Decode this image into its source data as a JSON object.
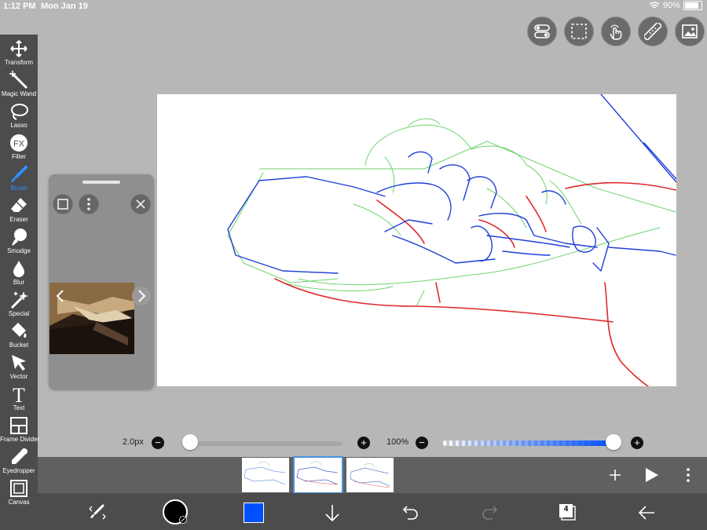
{
  "status": {
    "time": "1:12 PM",
    "date": "Mon Jan 19",
    "battery": "90%"
  },
  "tools": [
    {
      "label": "Transform",
      "icon": "move-icon"
    },
    {
      "label": "Magic Wand",
      "icon": "magic-wand-icon"
    },
    {
      "label": "Lasso",
      "icon": "lasso-icon"
    },
    {
      "label": "Filter",
      "icon": "fx-icon"
    },
    {
      "label": "Brush",
      "icon": "brush-icon",
      "active": true
    },
    {
      "label": "Eraser",
      "icon": "eraser-icon"
    },
    {
      "label": "Smudge",
      "icon": "smudge-icon"
    },
    {
      "label": "Blur",
      "icon": "blur-drop-icon"
    },
    {
      "label": "Special",
      "icon": "sparkle-icon"
    },
    {
      "label": "Bucket",
      "icon": "bucket-icon"
    },
    {
      "label": "Vector",
      "icon": "cursor-icon"
    },
    {
      "label": "Text",
      "icon": "text-icon"
    },
    {
      "label": "Frame Divider",
      "icon": "frame-divider-icon"
    },
    {
      "label": "Eyedropper",
      "icon": "eyedropper-icon"
    },
    {
      "label": "Canvas",
      "icon": "canvas-icon"
    }
  ],
  "top_buttons": [
    "toggle-icon",
    "selection-icon",
    "touch-icon",
    "ruler-icon",
    "image-icon"
  ],
  "brush": {
    "size_label": "2.0px",
    "size_fraction": 0.05
  },
  "opacity": {
    "label": "100%",
    "fraction": 1.0
  },
  "frames": {
    "count_label": "4",
    "selected": 2
  },
  "colors": {
    "accent": "#2f8fff",
    "current_color": "#0050ff",
    "toolbar": "#4c4c4c"
  }
}
